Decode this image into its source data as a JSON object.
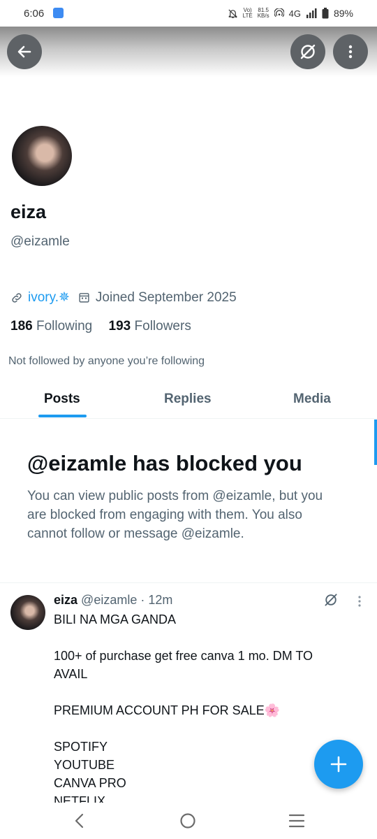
{
  "status_bar": {
    "time": "6:06",
    "volte": "Vo)",
    "lte": "LTE",
    "speed": "81.5",
    "speed_unit": "KB/s",
    "network": "4G",
    "battery": "89%"
  },
  "header": {
    "back_icon": "arrow-left-icon",
    "grok_icon": "slash-circle-icon",
    "more_icon": "more-vertical-icon"
  },
  "profile": {
    "name": "eiza",
    "handle": "@eizamle",
    "link": "ivory.✵",
    "joined": "Joined September 2025",
    "following_count": "186",
    "following_label": "Following",
    "followers_count": "193",
    "followers_label": "Followers",
    "not_followed": "Not followed by anyone you’re following"
  },
  "tabs": [
    {
      "label": "Posts",
      "active": true
    },
    {
      "label": "Replies",
      "active": false
    },
    {
      "label": "Media",
      "active": false
    }
  ],
  "blocked": {
    "title": "@eizamle has blocked you",
    "line1": "You can view public posts from @eizamle, but you",
    "line2": "are blocked from engaging with them. You also",
    "line3": "cannot follow or message @eizamle."
  },
  "post": {
    "author": "eiza",
    "handle": "@eizamle",
    "separator": "·",
    "time": "12m",
    "lines": [
      "BILI NA MGA GANDA",
      "",
      "100+ of purchase get free canva 1 mo. DM TO",
      "AVAIL",
      "",
      "PREMIUM ACCOUNT PH FOR SALE🌸",
      "",
      "SPOTIFY",
      "YOUTUBE",
      "CANVA PRO",
      "NETFLIX"
    ]
  },
  "fab": {
    "icon": "plus-icon"
  },
  "colors": {
    "accent": "#1d9bf0",
    "secondary_text": "#536471",
    "primary_text": "#0f1419"
  }
}
